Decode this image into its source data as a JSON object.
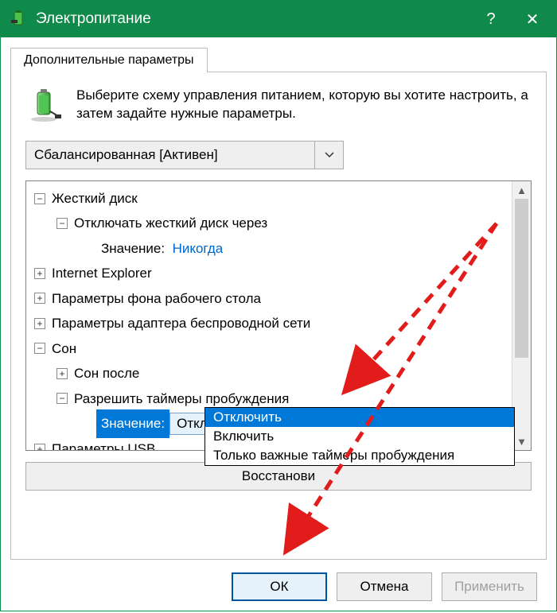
{
  "window": {
    "title": "Электропитание",
    "help_label": "?",
    "close_label": "✕"
  },
  "tab": {
    "label": "Дополнительные параметры"
  },
  "intro": {
    "text": "Выберите схему управления питанием, которую вы хотите настроить, а затем задайте нужные параметры."
  },
  "plan_combo": {
    "value": "Сбалансированная [Активен]"
  },
  "tree": {
    "hdd": {
      "label": "Жесткий диск",
      "turnoff": {
        "label": "Отключать жесткий диск через",
        "value_label": "Значение:",
        "value": "Никогда"
      }
    },
    "ie": {
      "label": "Internet Explorer"
    },
    "desktop_bg": {
      "label": "Параметры фона рабочего стола"
    },
    "wireless": {
      "label": "Параметры адаптера беспроводной сети"
    },
    "sleep": {
      "label": "Сон",
      "after": {
        "label": "Сон после"
      },
      "wake_timers": {
        "label": "Разрешить таймеры пробуждения",
        "value_label": "Значение:",
        "combo_value": "Отключить",
        "options": [
          "Отключить",
          "Включить",
          "Только важные таймеры пробуждения"
        ]
      }
    },
    "usb": {
      "label": "Параметры USB"
    }
  },
  "restore": {
    "label": "Восстановить значения по умолчанию"
  },
  "footer": {
    "ok": "ОК",
    "cancel": "Отмена",
    "apply": "Применить"
  }
}
